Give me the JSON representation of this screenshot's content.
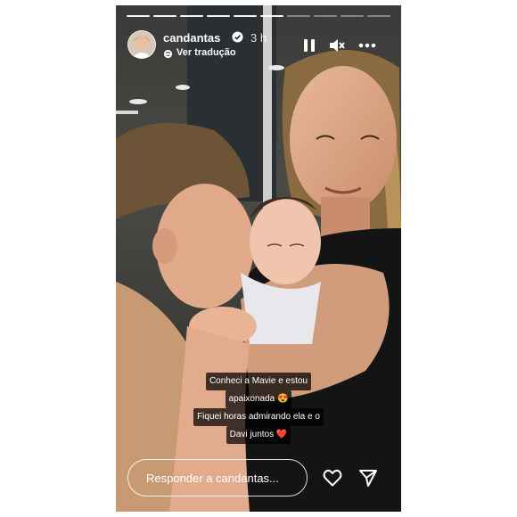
{
  "header": {
    "username": "candantas",
    "timestamp": "3 h",
    "translate_label": "Ver tradução",
    "verified": true,
    "progress": {
      "total_segments": 10,
      "completed_segments": 6
    }
  },
  "controls": {
    "pause_icon": "pause-icon",
    "mute_icon": "muted-speaker-icon",
    "more_icon": "more-options-icon"
  },
  "caption": {
    "line1": "Conheci a Mavie e estou",
    "line2": "apaixonada 😍",
    "line3": "Fiquei horas admirando ela e o",
    "line4": "Davi juntos ❤️"
  },
  "footer": {
    "reply_placeholder": "Responder a candantas..."
  },
  "colors": {
    "text": "#ffffff",
    "background": "#1a1a1a",
    "verified_badge": "#3897f0"
  }
}
